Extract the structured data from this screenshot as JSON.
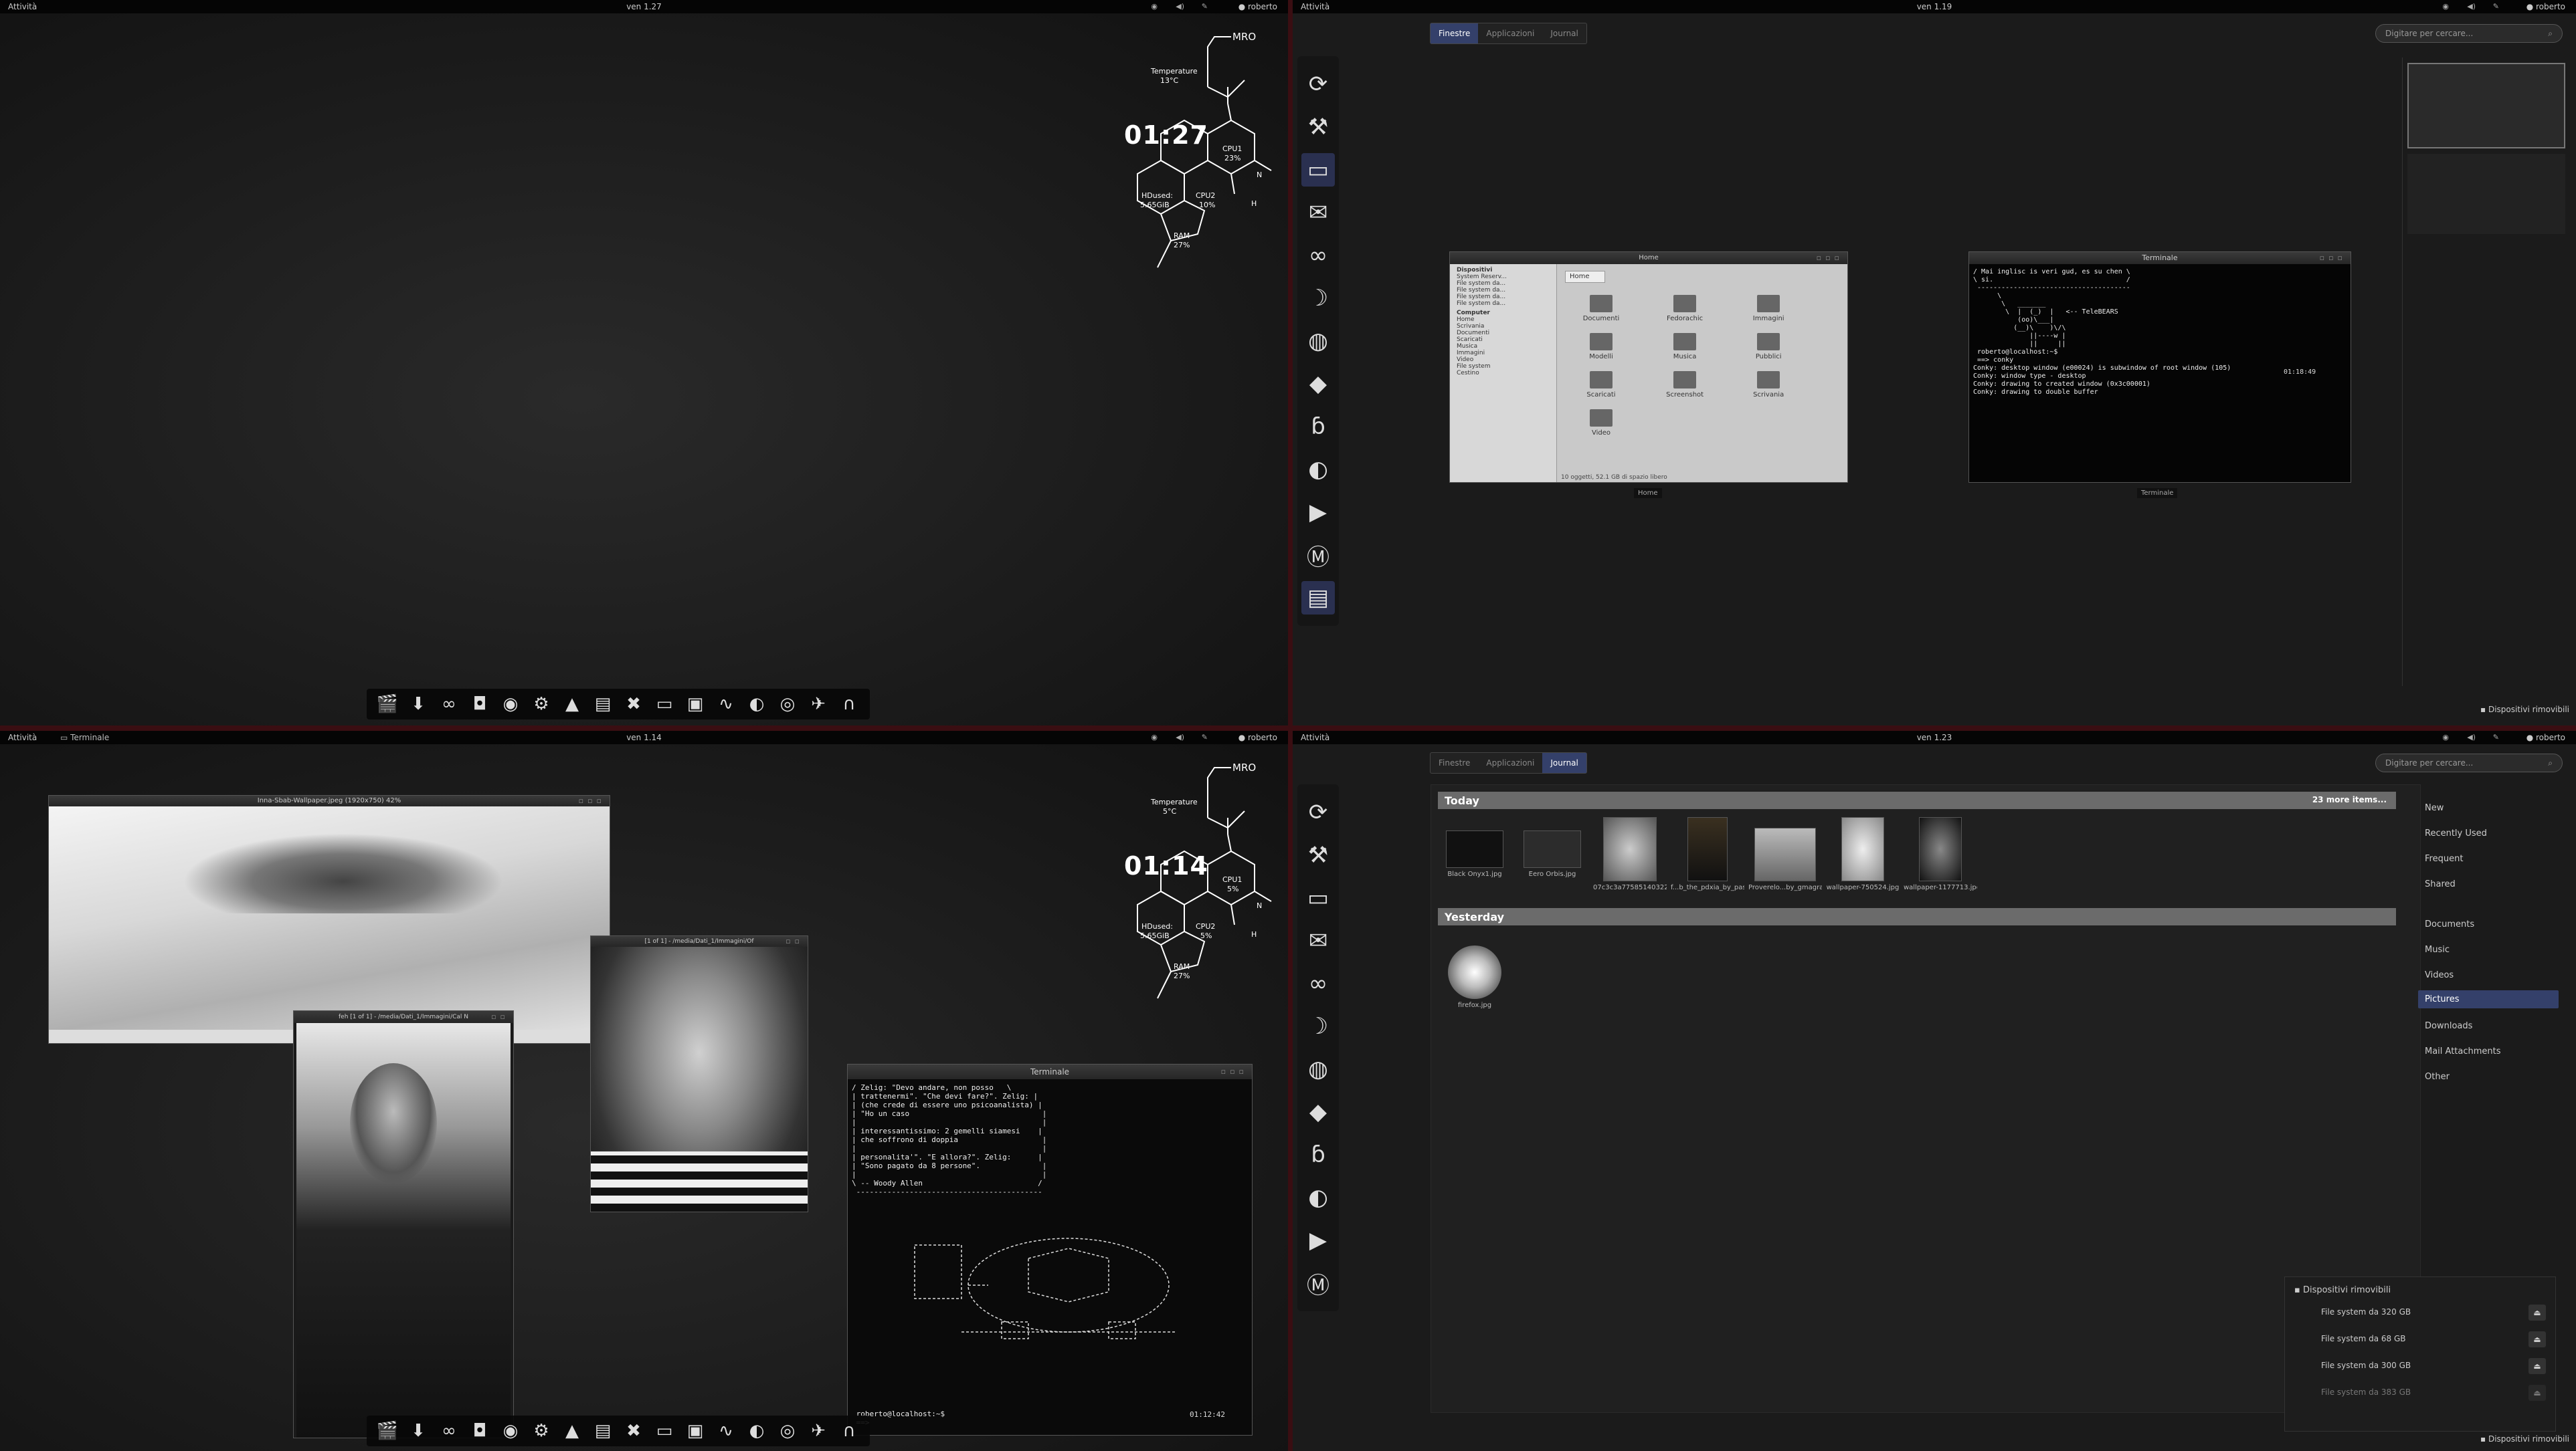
{
  "q1": {
    "topbar": {
      "activities": "Attività",
      "clock": "ven 1.27",
      "user": "roberto"
    },
    "conky": {
      "time": "01:27",
      "user": "MRO",
      "temp_label": "Temperature",
      "temp_value": "13°C",
      "cpu1": "CPU1",
      "cpu1_val": "23%",
      "cpu2": "CPU2",
      "cpu2_val": "10%",
      "hd_label": "HDused:",
      "hd_val": "5.65GiB",
      "ram": "RAM",
      "ram_val": "27%",
      "n": "N",
      "h": "H"
    },
    "dock_icons": [
      "clapper-icon",
      "download-icon",
      "glasses-icon",
      "camera-icon",
      "eye-icon",
      "settings-icon",
      "box-icon",
      "files-icon",
      "tools-icon",
      "terminal-icon",
      "monitor-icon",
      "waveform-icon",
      "firefox-icon",
      "chrome-icon",
      "bird-icon",
      "headphones-icon"
    ]
  },
  "q2": {
    "topbar": {
      "activities": "Attività",
      "clock": "ven 1.19",
      "user": "roberto"
    },
    "tabs": [
      "Finestre",
      "Applicazioni",
      "Journal"
    ],
    "search_placeholder": "Digitare per cercare...",
    "filemgr": {
      "title": "Home",
      "location": "Home",
      "sidebar_head1": "Dispositivi",
      "devices": [
        "System Reserv...",
        "File system da...",
        "File system da...",
        "File system da...",
        "File system da..."
      ],
      "sidebar_head2": "Computer",
      "places": [
        "Home",
        "Scrivania",
        "Documenti",
        "Scaricati",
        "Musica",
        "Immagini",
        "Video",
        "File system",
        "Cestino"
      ],
      "folders": [
        "Documenti",
        "Fedorachic",
        "Immagini",
        "Modelli",
        "Musica",
        "Pubblici",
        "Scaricati",
        "Screenshot",
        "Scrivania",
        "Video"
      ],
      "status": "10 oggetti, 52.1 GB di spazio libero",
      "caption": "Home"
    },
    "terminal": {
      "title": "Terminale",
      "caption": "Terminale",
      "lines": "/ Mai inglisc is veri gud, es su chen \\\n\\ si.                                 /\n --------------------------------------\n      \\\n       \\   _______\n        \\  |  (_)  |   <-- TeleBEARS\n           (oo)\\___|\n          (__)\\    )\\/\\\n              ||----w |\n              ||     ||\n roberto@localhost:~$\n ==> conky\nConky: desktop window (e00024) is subwindow of root window (105)\nConky: window type - desktop\nConky: drawing to created window (0x3c00001)\nConky: drawing to double buffer",
      "clock": "01:18:49"
    },
    "removable": "Dispositivi rimovibili"
  },
  "q3": {
    "topbar": {
      "activities": "Attività",
      "app": "Terminale",
      "clock": "ven 1.14",
      "user": "roberto"
    },
    "conky": {
      "time": "01:14",
      "user": "MRO",
      "temp_label": "Temperature",
      "temp_value": "5°C",
      "cpu1": "CPU1",
      "cpu1_val": "5%",
      "cpu2": "CPU2",
      "cpu2_val": "5%",
      "hd_label": "HDused:",
      "hd_val": "5.65GiB",
      "ram": "RAM",
      "ram_val": "27%",
      "n": "N",
      "h": "H"
    },
    "viewer1_title": "Inna-Sbab-Wallpaper.jpeg (1920x750) 42%",
    "viewer2_title": "feh [1 of 1] - /media/Dati_1/Immagini/Cal N",
    "viewer3_title": "[1 of 1] - /media/Dati_1/Immagini/Of",
    "terminal": {
      "title": "Terminale",
      "quote": "/ Zelig: \"Devo andare, non posso   \\\n| trattenermi\". \"Che devi fare?\". Zelig: |\n| (che crede di essere uno psicoanalista) |\n| \"Ho un caso                              |\n|                                          |\n| interessantissimo: 2 gemelli siamesi    |\n| che soffrono di doppia                   |\n|                                          |\n| personalita'\". \"E allora?\". Zelig:      |\n| \"Sono pagato da 8 persone\".              |\n|                                          |\n\\ -- Woody Allen                          /\n ------------------------------------------",
      "prompt": " roberto@localhost:~$\n ==> ",
      "clock": "01:12:42"
    }
  },
  "q4": {
    "topbar": {
      "activities": "Attività",
      "clock": "ven 1.23",
      "user": "roberto"
    },
    "tabs": [
      "Finestre",
      "Applicazioni",
      "Journal"
    ],
    "search_placeholder": "Digitare per cercare...",
    "today": "Today",
    "more": "23 more items...",
    "today_items": [
      "Black Onyx1.jpg",
      "Eero Orbis.jpg",
      "07c3c3a77585140322...",
      "f...b_the_pdxia_by_pas...",
      "Proverelo...by_gmagrao.jpg",
      "wallpaper-750524.jpg",
      "wallpaper-1177713.jpg"
    ],
    "yesterday": "Yesterday",
    "yesterday_items": [
      "firefox.jpg"
    ],
    "categories": [
      "New",
      "Recently Used",
      "Frequent",
      "Shared",
      "Documents",
      "Music",
      "Videos",
      "Pictures",
      "Downloads",
      "Mail Attachments",
      "Other"
    ],
    "removable": {
      "title": "Dispositivi rimovibili",
      "items": [
        "File system da 320 GB",
        "File system da 68 GB",
        "File system da 300 GB",
        "File system da 383 GB"
      ]
    },
    "removable_tab": "Dispositivi rimovibili"
  }
}
